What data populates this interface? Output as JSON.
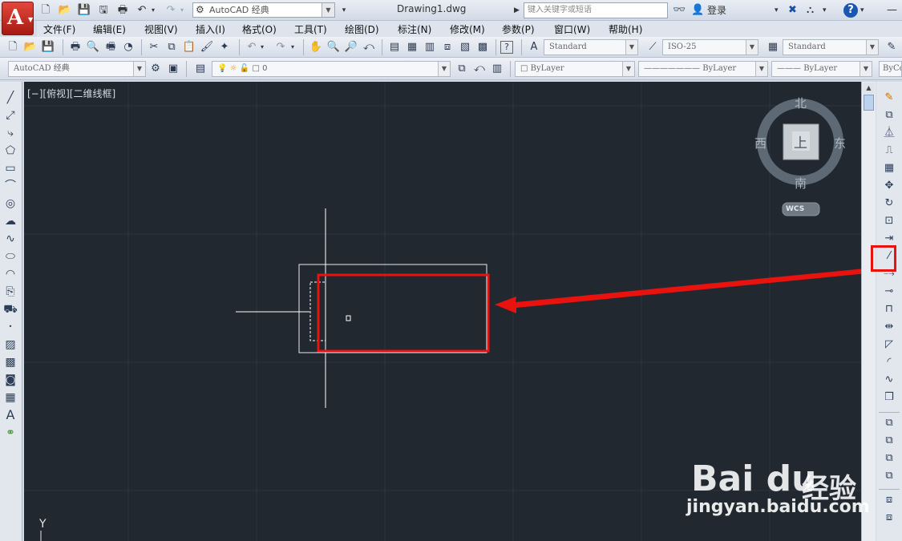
{
  "window": {
    "document_title": "Drawing1.dwg",
    "workspace_combo": "AutoCAD 经典",
    "search_placeholder": "键入关键字或短语",
    "login_label": "登录"
  },
  "menus": [
    "文件(F)",
    "编辑(E)",
    "视图(V)",
    "插入(I)",
    "格式(O)",
    "工具(T)",
    "绘图(D)",
    "标注(N)",
    "修改(M)",
    "参数(P)",
    "窗口(W)",
    "帮助(H)"
  ],
  "toolbar1": {
    "text_style": "Standard",
    "dim_style": "ISO-25",
    "table_style": "Standard",
    "truncated_combo": "Standa"
  },
  "toolbar2": {
    "workspace": "AutoCAD 经典",
    "layer": "0",
    "color": "ByLayer",
    "linetype": "ByLayer",
    "lineweight": "ByLayer",
    "plotstyle": "ByCo"
  },
  "canvas": {
    "viewport_label": "[−][俯视][二维线框]",
    "ucs_axis_label": "Y"
  },
  "viewcube": {
    "north": "北",
    "south": "南",
    "west": "西",
    "east": "东",
    "face": "上",
    "wcs_label": "WCS"
  },
  "watermark": {
    "logo": "Bai du",
    "chinese": "经验",
    "url": "jingyan.baidu.com"
  },
  "colors": {
    "canvas_bg": "#212830",
    "highlight_red": "#e8120f",
    "drawing_line": "#ffffff"
  }
}
